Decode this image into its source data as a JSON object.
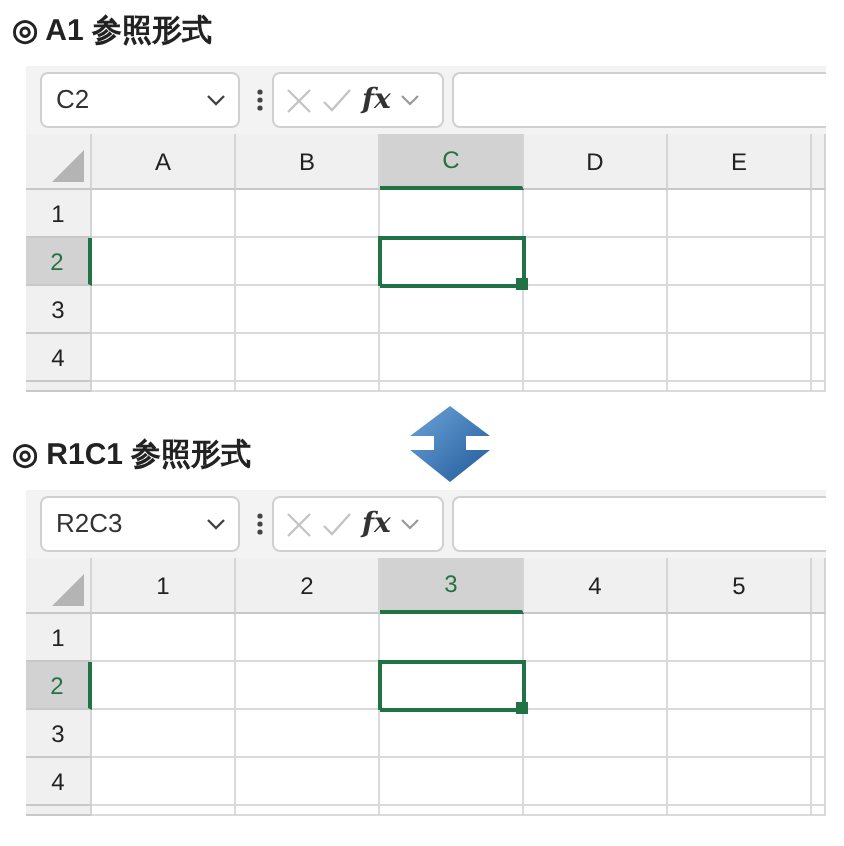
{
  "sections": [
    {
      "title": "◎ A1 参照形式",
      "name_box": "C2",
      "fx": "fx",
      "columns": [
        {
          "label": "A",
          "selected": false
        },
        {
          "label": "B",
          "selected": false
        },
        {
          "label": "C",
          "selected": true
        },
        {
          "label": "D",
          "selected": false
        },
        {
          "label": "E",
          "selected": false
        }
      ],
      "rows": [
        {
          "label": "1",
          "selected": false
        },
        {
          "label": "2",
          "selected": true
        },
        {
          "label": "3",
          "selected": false
        },
        {
          "label": "4",
          "selected": false
        }
      ]
    },
    {
      "title": "◎ R1C1 参照形式",
      "name_box": "R2C3",
      "fx": "fx",
      "columns": [
        {
          "label": "1",
          "selected": false
        },
        {
          "label": "2",
          "selected": false
        },
        {
          "label": "3",
          "selected": true
        },
        {
          "label": "4",
          "selected": false
        },
        {
          "label": "5",
          "selected": false
        }
      ],
      "rows": [
        {
          "label": "1",
          "selected": false
        },
        {
          "label": "2",
          "selected": true
        },
        {
          "label": "3",
          "selected": false
        },
        {
          "label": "4",
          "selected": false
        }
      ]
    }
  ]
}
